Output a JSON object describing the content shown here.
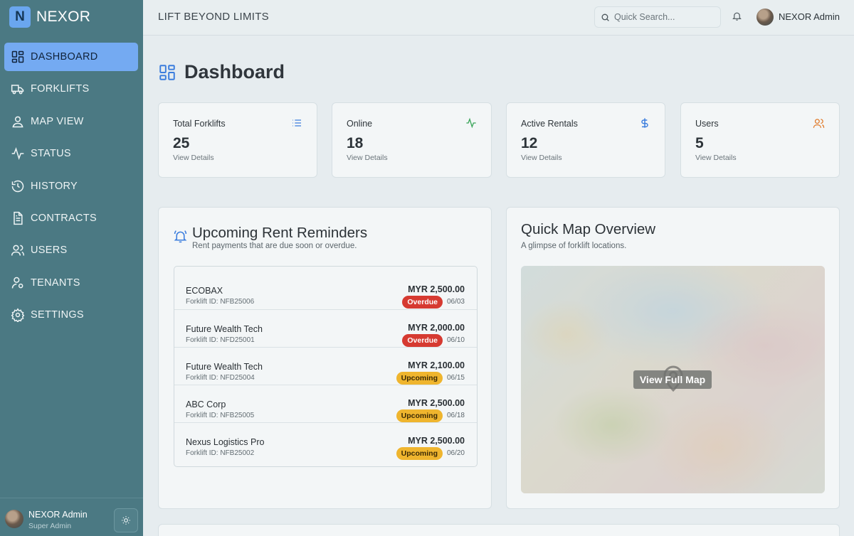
{
  "brand": {
    "logo_letter": "N",
    "name": "NEXOR"
  },
  "nav": [
    {
      "label": "DASHBOARD",
      "icon": "dashboard-icon",
      "active": true
    },
    {
      "label": "FORKLIFTS",
      "icon": "truck-icon"
    },
    {
      "label": "MAP VIEW",
      "icon": "map-pin-user-icon"
    },
    {
      "label": "STATUS",
      "icon": "activity-icon"
    },
    {
      "label": "HISTORY",
      "icon": "history-icon"
    },
    {
      "label": "CONTRACTS",
      "icon": "document-icon"
    },
    {
      "label": "USERS",
      "icon": "users-icon"
    },
    {
      "label": "TENANTS",
      "icon": "user-cog-icon"
    },
    {
      "label": "SETTINGS",
      "icon": "gear-icon"
    }
  ],
  "sidebar_user": {
    "name": "NEXOR Admin",
    "role": "Super Admin"
  },
  "topbar": {
    "tagline": "LIFT BEYOND LIMITS",
    "search_placeholder": "Quick Search...",
    "user_name": "NEXOR Admin"
  },
  "page": {
    "title": "Dashboard"
  },
  "stats": [
    {
      "label": "Total Forklifts",
      "value": "25",
      "link": "View Details",
      "icon": "list-icon",
      "color": "#3b7ddd"
    },
    {
      "label": "Online",
      "value": "18",
      "link": "View Details",
      "icon": "activity-icon",
      "color": "#3aa55a"
    },
    {
      "label": "Active Rentals",
      "value": "12",
      "link": "View Details",
      "icon": "dollar-icon",
      "color": "#3b7ddd"
    },
    {
      "label": "Users",
      "value": "5",
      "link": "View Details",
      "icon": "users-icon",
      "color": "#e07a2a"
    }
  ],
  "reminders": {
    "title": "Upcoming Rent Reminders",
    "subtitle": "Rent payments that are due soon or overdue.",
    "items": [
      {
        "name": "ECOBAX",
        "forklift_id": "Forklift ID: NFB25006",
        "amount": "MYR 2,500.00",
        "status": "Overdue",
        "date": "06/03"
      },
      {
        "name": "Future Wealth Tech",
        "forklift_id": "Forklift ID: NFD25001",
        "amount": "MYR 2,000.00",
        "status": "Overdue",
        "date": "06/10"
      },
      {
        "name": "Future Wealth Tech",
        "forklift_id": "Forklift ID: NFD25004",
        "amount": "MYR 2,100.00",
        "status": "Upcoming",
        "date": "06/15"
      },
      {
        "name": "ABC Corp",
        "forklift_id": "Forklift ID: NFB25005",
        "amount": "MYR 2,500.00",
        "status": "Upcoming",
        "date": "06/18"
      },
      {
        "name": "Nexus Logistics Pro",
        "forklift_id": "Forklift ID: NFB25002",
        "amount": "MYR 2,500.00",
        "status": "Upcoming",
        "date": "06/20"
      }
    ]
  },
  "map": {
    "title": "Quick Map Overview",
    "subtitle": "A glimpse of forklift locations.",
    "button": "View Full Map"
  }
}
